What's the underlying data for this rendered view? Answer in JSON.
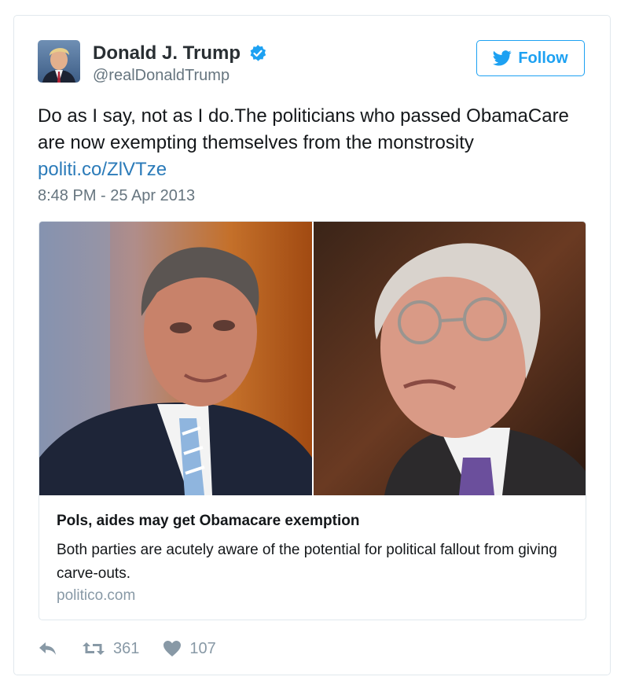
{
  "user": {
    "display_name": "Donald J. Trump",
    "handle": "@realDonaldTrump",
    "verified": true
  },
  "follow_button": {
    "label": "Follow"
  },
  "tweet": {
    "text": "Do as I say, not as I do.The politicians who passed ObamaCare are now exempting themselves from the monstrosity",
    "link": "politi.co/ZlVTze",
    "timestamp": "8:48 PM - 25 Apr 2013"
  },
  "card": {
    "title": "Pols, aides may get Obamacare exemption",
    "description": "Both parties are acutely aware of the potential for political fallout from giving carve-outs.",
    "domain": "politico.com"
  },
  "actions": {
    "reply_icon": "reply-icon",
    "retweet_icon": "retweet-icon",
    "retweet_count": "361",
    "like_icon": "heart-icon",
    "like_count": "107"
  },
  "colors": {
    "accent": "#1da1f2",
    "link": "#2b7bb9",
    "muted": "#8899a6",
    "border": "#e1e8ed"
  }
}
